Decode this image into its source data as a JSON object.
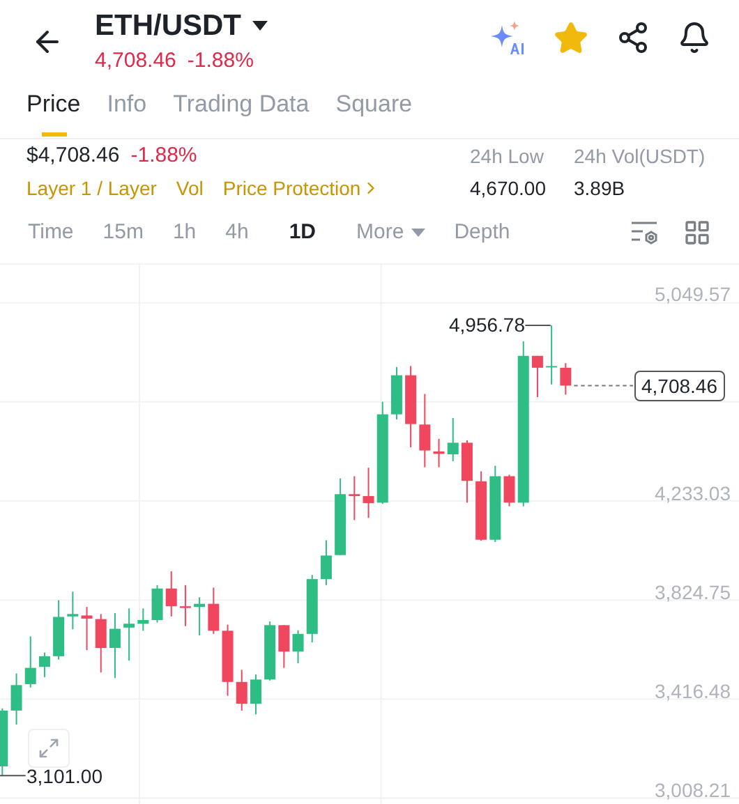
{
  "header": {
    "pair": "ETH/USDT",
    "price": "4,708.46",
    "change": "-1.88%",
    "favorite": true
  },
  "tabs": [
    {
      "label": "Price",
      "selected": true
    },
    {
      "label": "Info",
      "selected": false
    },
    {
      "label": "Trading Data",
      "selected": false
    },
    {
      "label": "Square",
      "selected": false
    }
  ],
  "summary": {
    "price": "$4,708.46",
    "change": "-1.88%",
    "tags": [
      {
        "label": "Layer 1 / Layer",
        "kind": "tag"
      },
      {
        "label": "Vol",
        "kind": "tag"
      },
      {
        "label": "Price Protection",
        "kind": "link"
      }
    ],
    "stats": [
      {
        "label": "24h Low",
        "value": "4,670.00"
      },
      {
        "label": "24h Vol(USDT)",
        "value": "3.89B"
      }
    ]
  },
  "intervals": [
    {
      "label": "Time",
      "kind": "option",
      "selected": false
    },
    {
      "label": "15m",
      "kind": "option",
      "selected": false
    },
    {
      "label": "1h",
      "kind": "option",
      "selected": false
    },
    {
      "label": "4h",
      "kind": "option",
      "selected": false
    },
    {
      "label": "1D",
      "kind": "option",
      "selected": true
    },
    {
      "label": "More",
      "kind": "menu",
      "selected": false
    },
    {
      "label": "Depth",
      "kind": "option",
      "selected": false
    }
  ],
  "chart": {
    "high_label": "4,956.78",
    "low_label": "3,101.00",
    "last_price": "4,708.46",
    "chart_data": {
      "type": "candlestick",
      "grid": true,
      "ylim": [
        3008.21,
        5049.57
      ],
      "ohlc": [
        [
          3139,
          3378,
          3101,
          3369
        ],
        [
          3369,
          3522,
          3311,
          3474
        ],
        [
          3478,
          3675,
          3464,
          3545
        ],
        [
          3549,
          3608,
          3507,
          3593
        ],
        [
          3593,
          3824,
          3579,
          3755
        ],
        [
          3757,
          3859,
          3704,
          3767
        ],
        [
          3761,
          3796,
          3618,
          3748
        ],
        [
          3746,
          3767,
          3526,
          3627
        ],
        [
          3627,
          3771,
          3503,
          3706
        ],
        [
          3711,
          3790,
          3575,
          3727
        ],
        [
          3727,
          3790,
          3698,
          3742
        ],
        [
          3742,
          3886,
          3732,
          3872
        ],
        [
          3872,
          3943,
          3757,
          3799
        ],
        [
          3799,
          3886,
          3717,
          3792
        ],
        [
          3796,
          3836,
          3679,
          3809
        ],
        [
          3809,
          3876,
          3685,
          3698
        ],
        [
          3698,
          3723,
          3430,
          3487
        ],
        [
          3487,
          3537,
          3369,
          3397
        ],
        [
          3397,
          3518,
          3353,
          3497
        ],
        [
          3497,
          3736,
          3493,
          3721
        ],
        [
          3721,
          3721,
          3545,
          3612
        ],
        [
          3612,
          3700,
          3564,
          3685
        ],
        [
          3685,
          3928,
          3650,
          3911
        ],
        [
          3911,
          4071,
          3886,
          4008
        ],
        [
          4010,
          4326,
          4010,
          4261
        ],
        [
          4261,
          4335,
          4154,
          4253
        ],
        [
          4253,
          4370,
          4163,
          4224
        ],
        [
          4226,
          4642,
          4221,
          4590
        ],
        [
          4590,
          4785,
          4569,
          4751
        ],
        [
          4751,
          4789,
          4454,
          4550
        ],
        [
          4548,
          4674,
          4372,
          4441
        ],
        [
          4437,
          4489,
          4372,
          4427
        ],
        [
          4425,
          4575,
          4397,
          4473
        ],
        [
          4473,
          4483,
          4226,
          4316
        ],
        [
          4314,
          4355,
          4069,
          4073
        ],
        [
          4073,
          4378,
          4064,
          4335
        ],
        [
          4335,
          4341,
          4211,
          4226
        ],
        [
          4226,
          4891,
          4211,
          4831
        ],
        [
          4831,
          4831,
          4661,
          4782
        ],
        [
          4784,
          4956.78,
          4713,
          4789
        ],
        [
          4782,
          4801,
          4671,
          4708.46
        ]
      ],
      "yticks": [
        {
          "value": 5049.57,
          "label": "5,049.57"
        },
        {
          "value": 4233.03,
          "label": "4,233.03"
        },
        {
          "value": 3824.75,
          "label": "3,824.75"
        },
        {
          "value": 3416.48,
          "label": "3,416.48"
        },
        {
          "value": 3008.21,
          "label": "3,008.21"
        }
      ]
    }
  }
}
